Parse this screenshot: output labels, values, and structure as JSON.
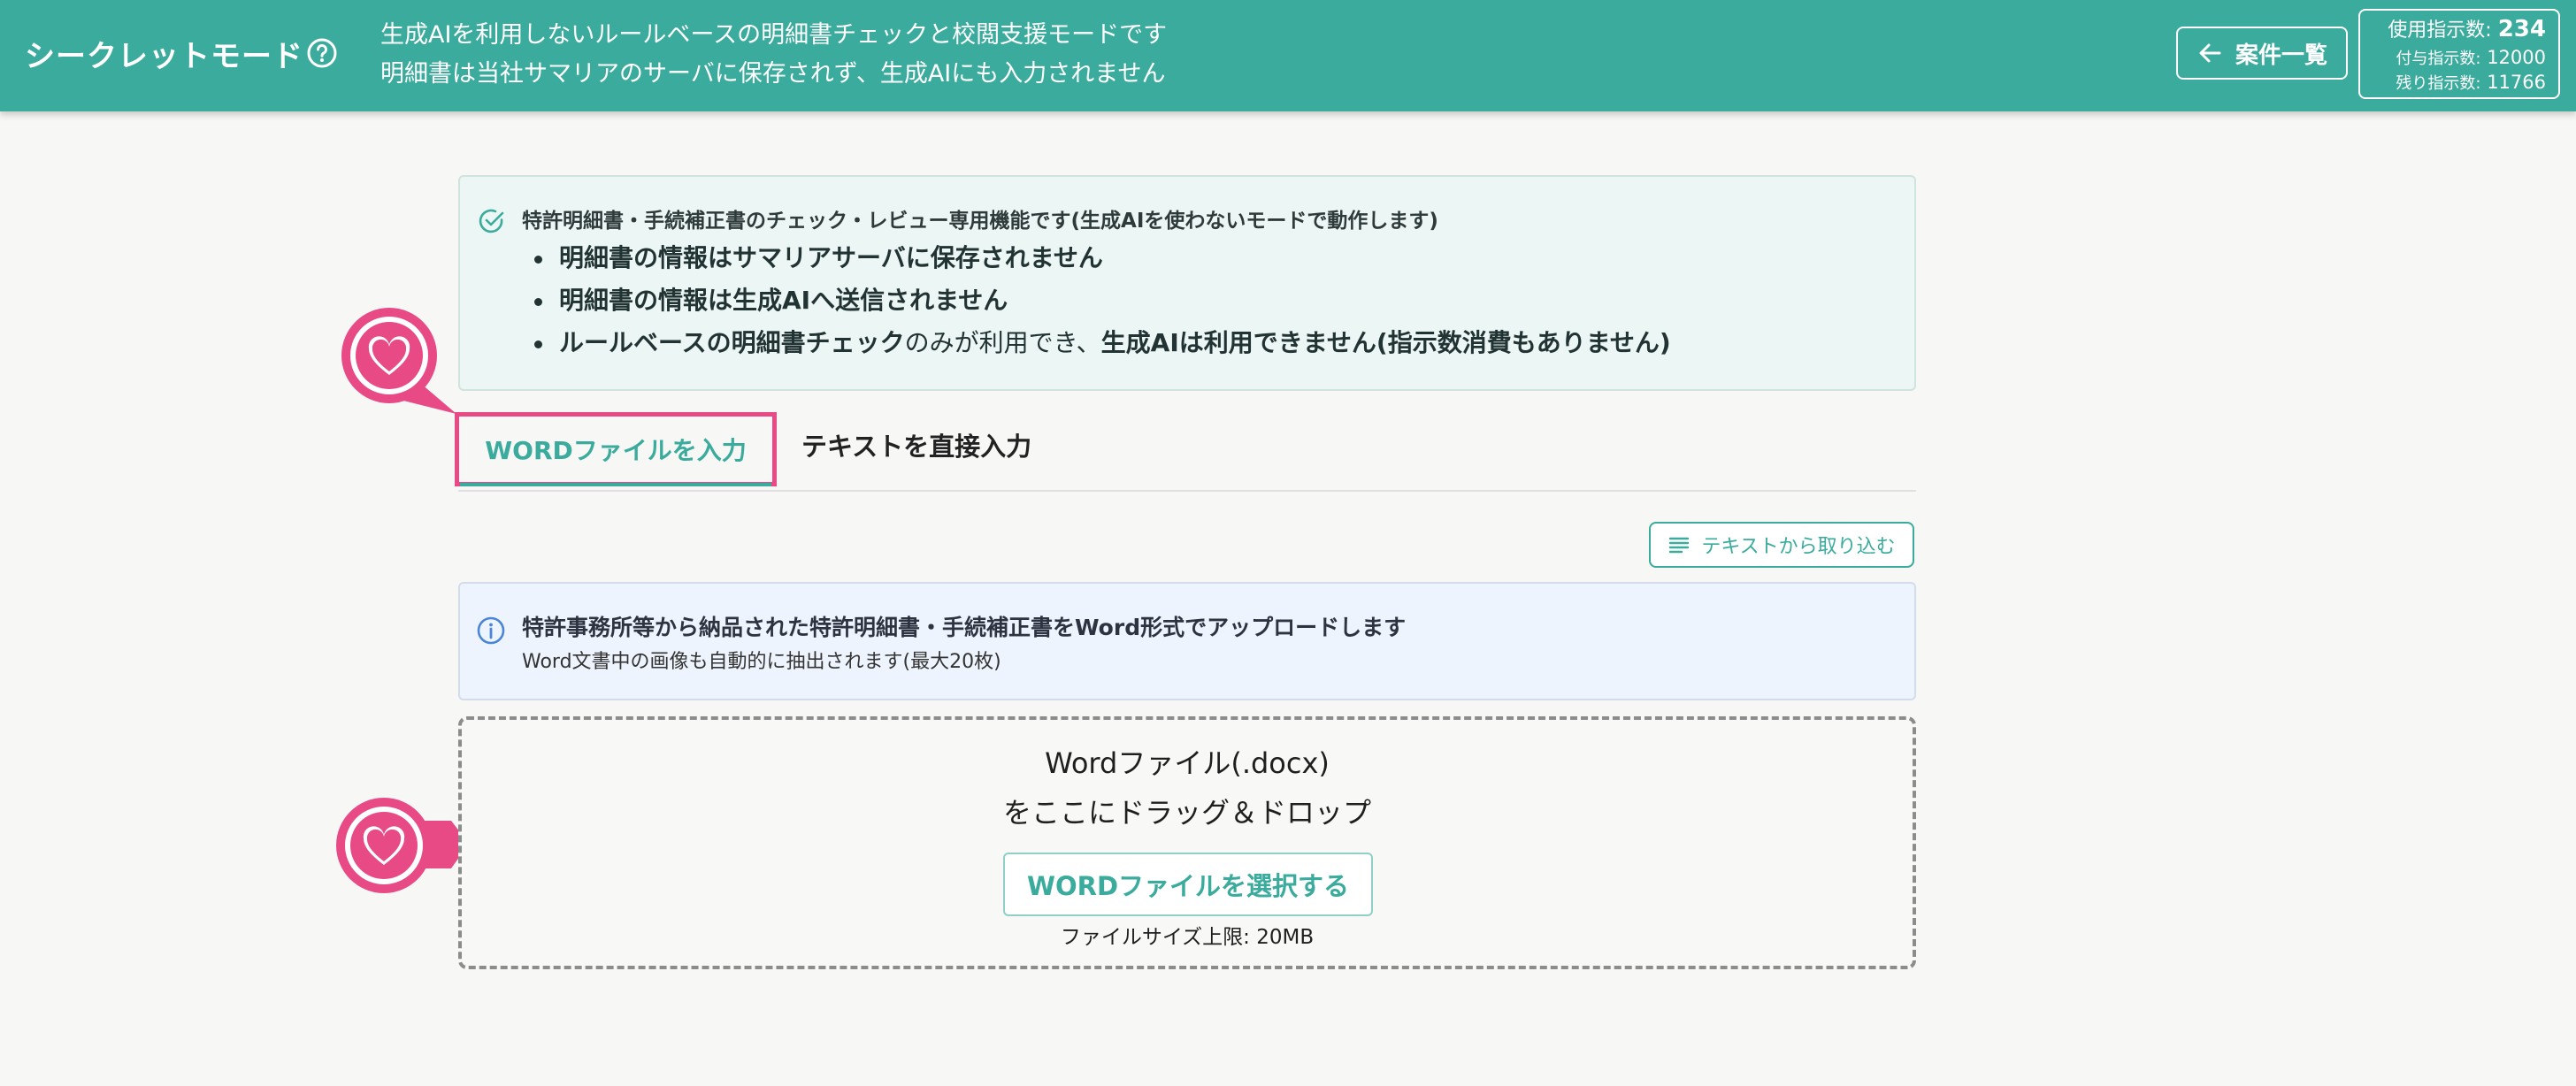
{
  "header": {
    "title": "シークレットモード",
    "description_line1": "生成AIを利用しないルールベースの明細書チェックと校閲支援モードです",
    "description_line2": "明細書は当社サマリアのサーバに保存されず、生成AIにも入力されません",
    "back_label": "案件一覧",
    "usage": {
      "used_label": "使用指示数:",
      "used_value": "234",
      "granted_label": "付与指示数:",
      "granted_value": "12000",
      "remaining_label": "残り指示数:",
      "remaining_value": "11766"
    }
  },
  "notice": {
    "title": "特許明細書・手続補正書のチェック・レビュー専用機能です(生成AIを使わないモードで動作します)",
    "item1": "明細書の情報はサマリアサーバに保存されません",
    "item2": "明細書の情報は生成AIへ送信されません",
    "item3_a": "ルールベースの明細書チェック",
    "item3_b": "のみが利用でき、",
    "item3_c": "生成AIは利用できません(指示数消費もありません)"
  },
  "tabs": {
    "word": "WORDファイルを入力",
    "text": "テキストを直接入力"
  },
  "import_button": "テキストから取り込む",
  "upload_info": {
    "title": "特許事務所等から納品された特許明細書・手続補正書をWord形式でアップロードします",
    "sub": "Word文書中の画像も自動的に抽出されます(最大20枚)"
  },
  "drop_zone": {
    "line1": "Wordファイル(.docx)",
    "line2": "をここにドラッグ＆ドロップ",
    "select_button": "WORDファイルを選択する",
    "size_limit": "ファイルサイズ上限: 20MB"
  },
  "colors": {
    "primary": "#3aab9c",
    "highlight": "#e84a86"
  },
  "icons": {
    "help": "help-circle-icon",
    "back": "arrow-left-icon",
    "check": "check-circle-icon",
    "info": "info-circle-icon",
    "lines": "lines-icon",
    "heart": "heart-marker-icon"
  }
}
